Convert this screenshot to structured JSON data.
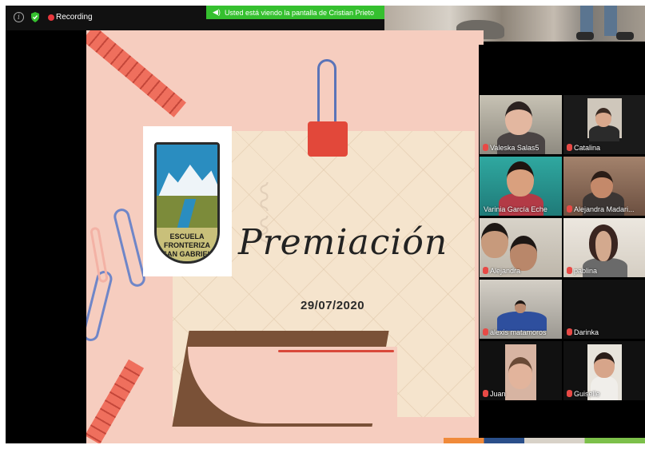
{
  "status": {
    "recording_label": "Recording"
  },
  "share_banner": {
    "text": "Usted está viendo la pantalla de Cristian Prieto"
  },
  "slide": {
    "logo_line1": "ESCUELA FRONTERIZA",
    "logo_line2": "SAN GABRIEL",
    "title": "Premiación",
    "date": "29/07/2020"
  },
  "participants": [
    {
      "name": "Valeska Salas5"
    },
    {
      "name": "Catalina"
    },
    {
      "name": "Varinia García Eche"
    },
    {
      "name": "Alejandra Madari..."
    },
    {
      "name": "Alejandra"
    },
    {
      "name": "pablina"
    },
    {
      "name": "alexis matamoros"
    },
    {
      "name": "Darinka"
    },
    {
      "name": "Juan"
    },
    {
      "name": "Guiselle"
    }
  ],
  "colors": {
    "share_banner": "#35c02f",
    "recording": "#e8373d",
    "active_speaker": "#e6e86a",
    "slide_bg": "#f6cdbf"
  }
}
